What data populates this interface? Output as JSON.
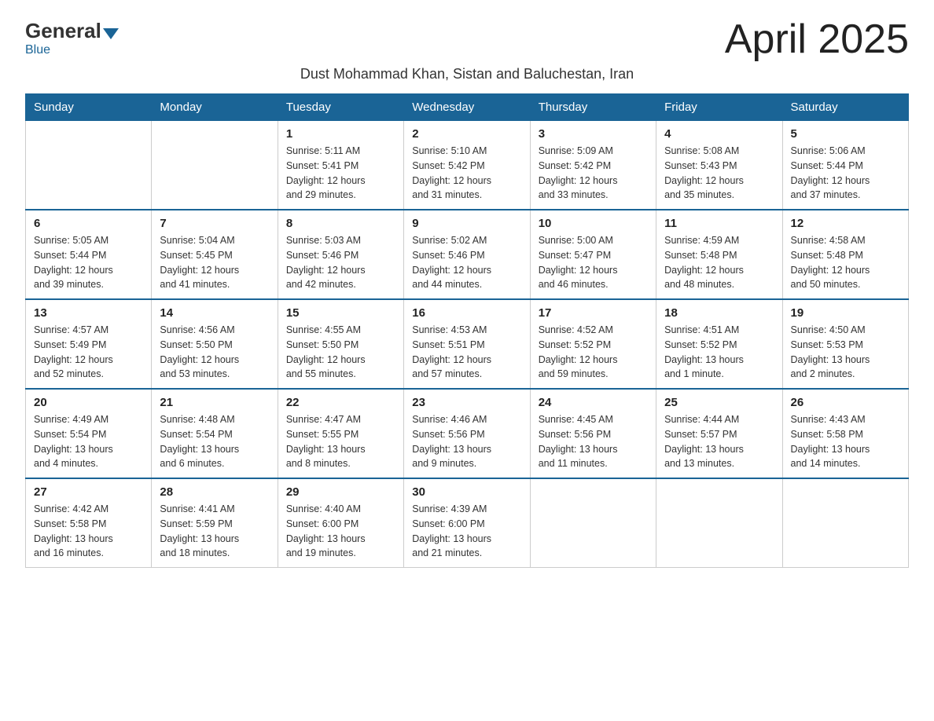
{
  "header": {
    "logo_general": "General",
    "logo_blue": "Blue",
    "title": "April 2025",
    "subtitle": "Dust Mohammad Khan, Sistan and Baluchestan, Iran"
  },
  "weekdays": [
    "Sunday",
    "Monday",
    "Tuesday",
    "Wednesday",
    "Thursday",
    "Friday",
    "Saturday"
  ],
  "weeks": [
    [
      {
        "day": "",
        "info": ""
      },
      {
        "day": "",
        "info": ""
      },
      {
        "day": "1",
        "info": "Sunrise: 5:11 AM\nSunset: 5:41 PM\nDaylight: 12 hours\nand 29 minutes."
      },
      {
        "day": "2",
        "info": "Sunrise: 5:10 AM\nSunset: 5:42 PM\nDaylight: 12 hours\nand 31 minutes."
      },
      {
        "day": "3",
        "info": "Sunrise: 5:09 AM\nSunset: 5:42 PM\nDaylight: 12 hours\nand 33 minutes."
      },
      {
        "day": "4",
        "info": "Sunrise: 5:08 AM\nSunset: 5:43 PM\nDaylight: 12 hours\nand 35 minutes."
      },
      {
        "day": "5",
        "info": "Sunrise: 5:06 AM\nSunset: 5:44 PM\nDaylight: 12 hours\nand 37 minutes."
      }
    ],
    [
      {
        "day": "6",
        "info": "Sunrise: 5:05 AM\nSunset: 5:44 PM\nDaylight: 12 hours\nand 39 minutes."
      },
      {
        "day": "7",
        "info": "Sunrise: 5:04 AM\nSunset: 5:45 PM\nDaylight: 12 hours\nand 41 minutes."
      },
      {
        "day": "8",
        "info": "Sunrise: 5:03 AM\nSunset: 5:46 PM\nDaylight: 12 hours\nand 42 minutes."
      },
      {
        "day": "9",
        "info": "Sunrise: 5:02 AM\nSunset: 5:46 PM\nDaylight: 12 hours\nand 44 minutes."
      },
      {
        "day": "10",
        "info": "Sunrise: 5:00 AM\nSunset: 5:47 PM\nDaylight: 12 hours\nand 46 minutes."
      },
      {
        "day": "11",
        "info": "Sunrise: 4:59 AM\nSunset: 5:48 PM\nDaylight: 12 hours\nand 48 minutes."
      },
      {
        "day": "12",
        "info": "Sunrise: 4:58 AM\nSunset: 5:48 PM\nDaylight: 12 hours\nand 50 minutes."
      }
    ],
    [
      {
        "day": "13",
        "info": "Sunrise: 4:57 AM\nSunset: 5:49 PM\nDaylight: 12 hours\nand 52 minutes."
      },
      {
        "day": "14",
        "info": "Sunrise: 4:56 AM\nSunset: 5:50 PM\nDaylight: 12 hours\nand 53 minutes."
      },
      {
        "day": "15",
        "info": "Sunrise: 4:55 AM\nSunset: 5:50 PM\nDaylight: 12 hours\nand 55 minutes."
      },
      {
        "day": "16",
        "info": "Sunrise: 4:53 AM\nSunset: 5:51 PM\nDaylight: 12 hours\nand 57 minutes."
      },
      {
        "day": "17",
        "info": "Sunrise: 4:52 AM\nSunset: 5:52 PM\nDaylight: 12 hours\nand 59 minutes."
      },
      {
        "day": "18",
        "info": "Sunrise: 4:51 AM\nSunset: 5:52 PM\nDaylight: 13 hours\nand 1 minute."
      },
      {
        "day": "19",
        "info": "Sunrise: 4:50 AM\nSunset: 5:53 PM\nDaylight: 13 hours\nand 2 minutes."
      }
    ],
    [
      {
        "day": "20",
        "info": "Sunrise: 4:49 AM\nSunset: 5:54 PM\nDaylight: 13 hours\nand 4 minutes."
      },
      {
        "day": "21",
        "info": "Sunrise: 4:48 AM\nSunset: 5:54 PM\nDaylight: 13 hours\nand 6 minutes."
      },
      {
        "day": "22",
        "info": "Sunrise: 4:47 AM\nSunset: 5:55 PM\nDaylight: 13 hours\nand 8 minutes."
      },
      {
        "day": "23",
        "info": "Sunrise: 4:46 AM\nSunset: 5:56 PM\nDaylight: 13 hours\nand 9 minutes."
      },
      {
        "day": "24",
        "info": "Sunrise: 4:45 AM\nSunset: 5:56 PM\nDaylight: 13 hours\nand 11 minutes."
      },
      {
        "day": "25",
        "info": "Sunrise: 4:44 AM\nSunset: 5:57 PM\nDaylight: 13 hours\nand 13 minutes."
      },
      {
        "day": "26",
        "info": "Sunrise: 4:43 AM\nSunset: 5:58 PM\nDaylight: 13 hours\nand 14 minutes."
      }
    ],
    [
      {
        "day": "27",
        "info": "Sunrise: 4:42 AM\nSunset: 5:58 PM\nDaylight: 13 hours\nand 16 minutes."
      },
      {
        "day": "28",
        "info": "Sunrise: 4:41 AM\nSunset: 5:59 PM\nDaylight: 13 hours\nand 18 minutes."
      },
      {
        "day": "29",
        "info": "Sunrise: 4:40 AM\nSunset: 6:00 PM\nDaylight: 13 hours\nand 19 minutes."
      },
      {
        "day": "30",
        "info": "Sunrise: 4:39 AM\nSunset: 6:00 PM\nDaylight: 13 hours\nand 21 minutes."
      },
      {
        "day": "",
        "info": ""
      },
      {
        "day": "",
        "info": ""
      },
      {
        "day": "",
        "info": ""
      }
    ]
  ]
}
